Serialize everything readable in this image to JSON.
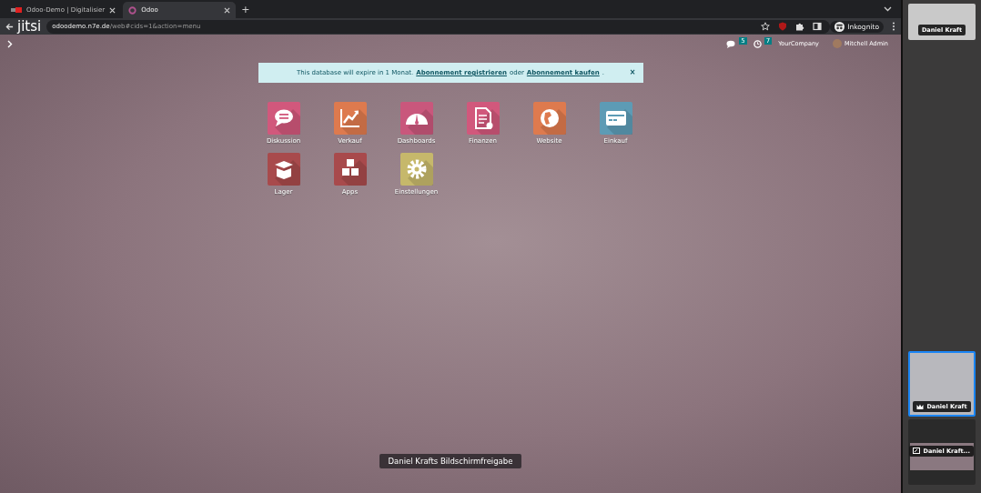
{
  "browser": {
    "tabs": [
      {
        "title": "Odoo-Demo | Digitalisier",
        "selected": false
      },
      {
        "title": "Odoo",
        "selected": true
      }
    ],
    "new_tab": "+",
    "url_host": "odoodemo.n7e.de",
    "url_path": "/web#cids=1&action=menu",
    "profile": "Inkognito"
  },
  "overlay_logo": "jitsi",
  "systray": {
    "messages_count": "5",
    "activities_count": "7",
    "company": "YourCompany",
    "user": "Mitchell Admin"
  },
  "notice": {
    "before": "This database will expire in 1 Monat.",
    "link_1": "Abonnement registrieren",
    "middle": "oder",
    "link_2": "Abonnement kaufen",
    "after": ".",
    "close": "×"
  },
  "apps": [
    {
      "label": "Diskussion",
      "kind": "chat",
      "color": "#d1587c"
    },
    {
      "label": "Verkauf",
      "kind": "chart",
      "color": "#de7a4e"
    },
    {
      "label": "Dashboards",
      "kind": "gauge",
      "color": "#c9577c"
    },
    {
      "label": "Finanzen",
      "kind": "document",
      "color": "#d1587c"
    },
    {
      "label": "Website",
      "kind": "globe",
      "color": "#de7a4e"
    },
    {
      "label": "Einkauf",
      "kind": "card",
      "color": "#5d9bb5"
    },
    {
      "label": "Lager",
      "kind": "box",
      "color": "#a84a4c"
    },
    {
      "label": "Apps",
      "kind": "cubes",
      "color": "#a84a4c"
    },
    {
      "label": "Einstellungen",
      "kind": "gear",
      "color": "#c6b86b"
    }
  ],
  "screen_share_label": "Daniel Krafts Bildschirmfreigabe",
  "participants": [
    {
      "name": "Daniel Kraft",
      "kind": "camera",
      "selected": false
    },
    {
      "name": "Daniel Kraft",
      "kind": "moderator",
      "selected": true
    },
    {
      "name": "Daniel Kraft...",
      "kind": "screen",
      "selected": false
    }
  ]
}
